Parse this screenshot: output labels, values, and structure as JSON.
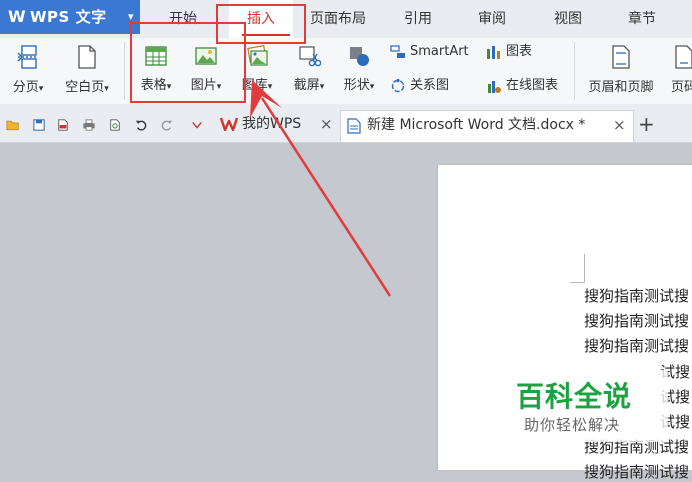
{
  "app": {
    "logo_glyph": "W",
    "name": "WPS 文字",
    "caret": "▾"
  },
  "menu_tabs": [
    {
      "label": "开始"
    },
    {
      "label": "插入",
      "active": true
    },
    {
      "label": "页面布局"
    },
    {
      "label": "引用"
    },
    {
      "label": "审阅"
    },
    {
      "label": "视图"
    },
    {
      "label": "章节"
    }
  ],
  "ribbon": {
    "page_break": "分页",
    "blank_page": "空白页",
    "table": "表格",
    "picture": "图片",
    "gallery": "图库",
    "screenshot": "截屏",
    "shapes": "形状",
    "smartart": "SmartArt",
    "chart": "图表",
    "relation_chart": "关系图",
    "online_chart": "在线图表",
    "header_footer": "页眉和页脚",
    "page_number": "页码",
    "dropdown_caret": "▾"
  },
  "doc_tabs": [
    {
      "label": "我的WPS",
      "close": "×"
    },
    {
      "label": "新建 Microsoft Word 文档.docx *",
      "close": "×",
      "active": true
    }
  ],
  "new_tab": "+",
  "document": {
    "lines": [
      "搜狗指南测试搜",
      "搜狗指南测试搜",
      "搜狗指南测试搜",
      "试搜",
      "试搜",
      "试搜",
      "搜狗指南测试搜",
      "搜狗指南测试搜"
    ]
  },
  "watermark": {
    "title": "百科全说",
    "subtitle": "助你轻松解决"
  },
  "colors": {
    "accent": "#3a78d4",
    "active_tab": "#d0352a",
    "highlight": "#e23b3b",
    "watermark": "#1aa33f"
  }
}
